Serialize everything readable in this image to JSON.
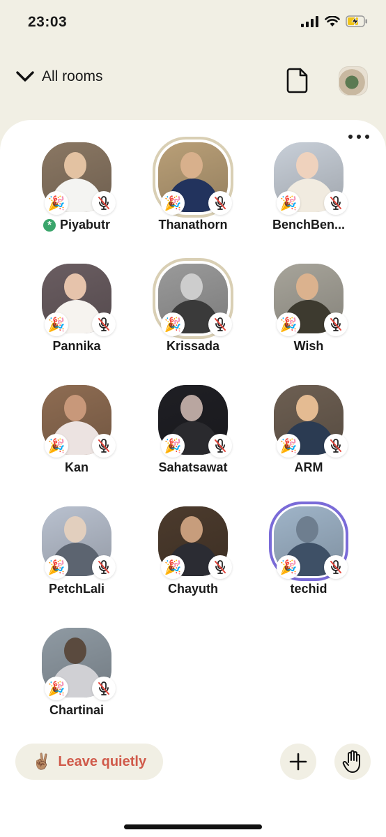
{
  "status_bar": {
    "time": "23:03"
  },
  "nav": {
    "all_rooms_label": "All rooms"
  },
  "speakers": [
    {
      "name": "Piyabutr",
      "moderator_icon": "*",
      "party_icon": "🎉",
      "photo": {
        "bg": "#8a7763",
        "skin": "#e3c2a2",
        "shirt": "#f4f4f2"
      }
    },
    {
      "name": "Thanathorn",
      "party_icon": "🎉",
      "photo": {
        "bg": "#b99f77",
        "skin": "#d8b08c",
        "shirt": "#22335d"
      }
    },
    {
      "name": "BenchBen...",
      "party_icon": "🎉",
      "photo": {
        "bg": "#c8cfd8",
        "skin": "#efd2bd",
        "shirt": "#f1ebe0"
      }
    },
    {
      "name": "Pannika",
      "party_icon": "🎉",
      "photo": {
        "bg": "#6a5d61",
        "skin": "#e6c3ab",
        "shirt": "#f6f3ef"
      }
    },
    {
      "name": "Krissada",
      "party_icon": "🎉",
      "photo": {
        "bg": "#9a9a9a",
        "skin": "#cdcdcd",
        "shirt": "#3a3a3a"
      }
    },
    {
      "name": "Wish",
      "party_icon": "🎉",
      "photo": {
        "bg": "#a7a49a",
        "skin": "#dbb28e",
        "shirt": "#3d3a2f"
      }
    },
    {
      "name": "Kan",
      "party_icon": "🎉",
      "photo": {
        "bg": "#8e6c52",
        "skin": "#c8987a",
        "shirt": "#ece3e1"
      }
    },
    {
      "name": "Sahatsawat",
      "party_icon": "🎉",
      "photo": {
        "bg": "#1f1f24",
        "skin": "#b9a6a0",
        "shirt": "#2a2a2e"
      }
    },
    {
      "name": "ARM",
      "party_icon": "🎉",
      "photo": {
        "bg": "#6d5f52",
        "skin": "#e4bb92",
        "shirt": "#2b3b52"
      }
    },
    {
      "name": "PetchLali",
      "party_icon": "🎉",
      "photo": {
        "bg": "#b9c1cf",
        "skin": "#e2cfbe",
        "shirt": "#5c6470"
      }
    },
    {
      "name": "Chayuth",
      "party_icon": "🎉",
      "photo": {
        "bg": "#4c3b2d",
        "skin": "#c79d7c",
        "shirt": "#2b2c33"
      }
    },
    {
      "name": "techid",
      "party_icon": "🎉",
      "photo": {
        "bg": "#9fb4c8",
        "skin": "#6e7e8f",
        "shirt": "#3e5066"
      }
    },
    {
      "name": "Chartinai",
      "party_icon": "🎉",
      "photo": {
        "bg": "#8f9aa3",
        "skin": "#5a4a3e",
        "shirt": "#d0d0d4"
      }
    }
  ],
  "bottom_bar": {
    "leave_emoji": "✌🏽",
    "leave_label": "Leave quietly"
  },
  "colors": {
    "background": "#f1efe4",
    "panel": "#ffffff",
    "leave_text": "#d05a4a",
    "moderator_badge": "#3aa56b"
  }
}
